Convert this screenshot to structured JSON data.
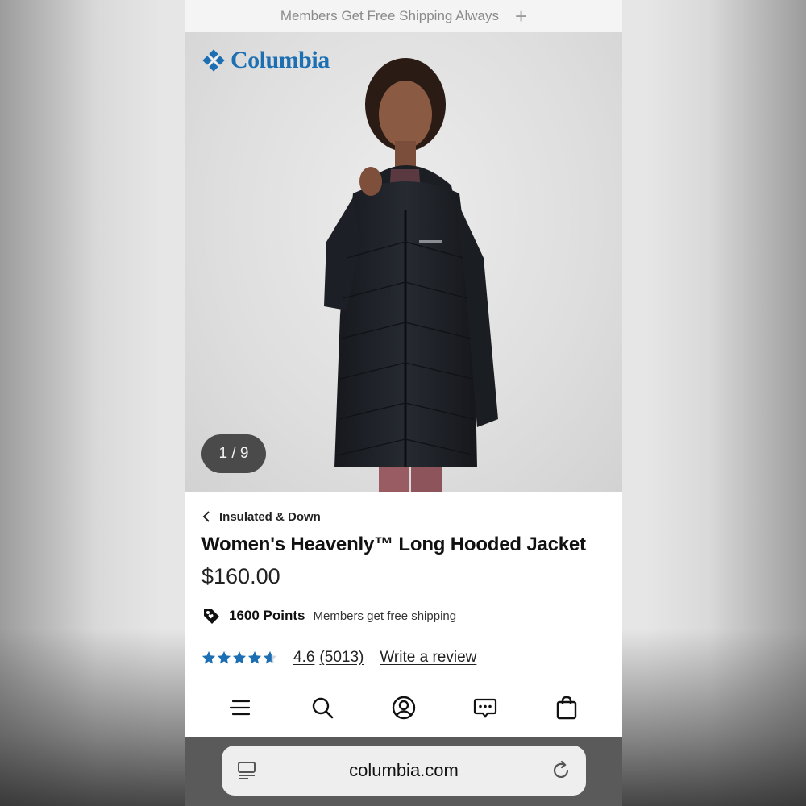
{
  "promo": {
    "text": "Members Get Free Shipping Always",
    "expand_icon": "plus-icon"
  },
  "brand": {
    "name": "Columbia",
    "color": "#1d6fb3"
  },
  "gallery": {
    "counter": "1 / 9"
  },
  "breadcrumb": {
    "label": "Insulated & Down"
  },
  "product": {
    "title": "Women's Heavenly™ Long Hooded Jacket",
    "price": "$160.00",
    "points": "1600 Points",
    "shipping_note": "Members get free shipping"
  },
  "rating": {
    "score": "4.6",
    "count": "(5013)",
    "stars_value": 4.6,
    "star_color": "#1d6fb3",
    "write_review": "Write a review"
  },
  "nav": {
    "items": [
      "menu-icon",
      "search-icon",
      "account-icon",
      "chat-icon",
      "bag-icon"
    ]
  },
  "browser": {
    "url": "columbia.com"
  }
}
